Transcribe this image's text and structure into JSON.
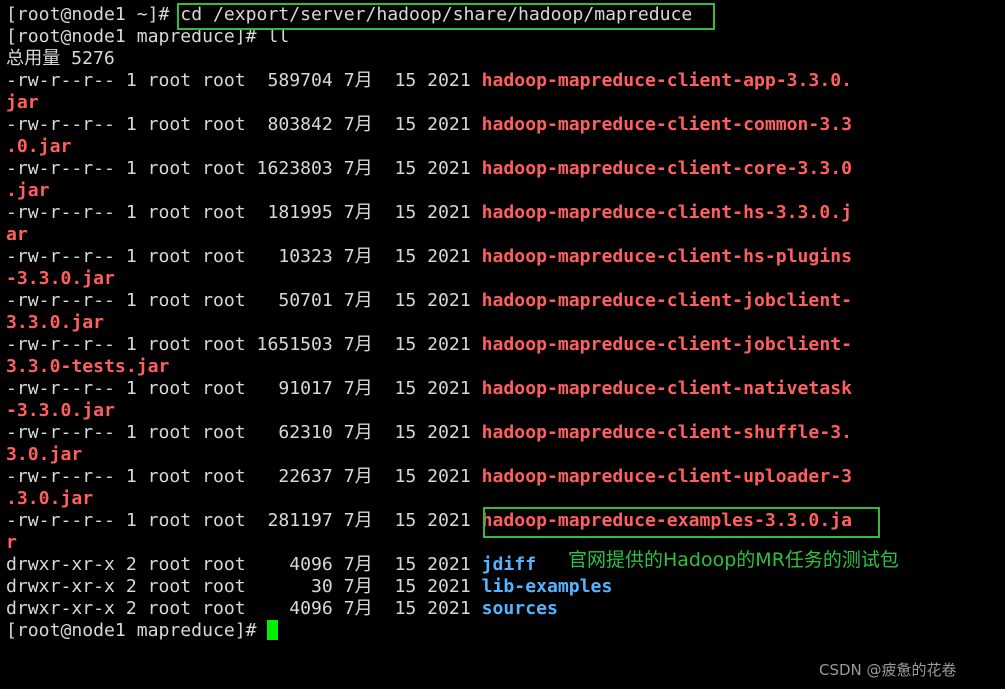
{
  "terminal": {
    "line1_prompt": "[root@node1 ~]# ",
    "line1_command": "cd /export/server/hadoop/share/hadoop/mapreduce",
    "line2_prompt": "[root@node1 mapreduce]# ",
    "line2_command": "ll",
    "total": "总用量 5276",
    "files": [
      {
        "info": "-rw-r--r-- 1 root root  589704 7月  15 2021 ",
        "name_line1": "hadoop-mapreduce-client-app-3.3.0.",
        "name_line2": "jar"
      },
      {
        "info": "-rw-r--r-- 1 root root  803842 7月  15 2021 ",
        "name_line1": "hadoop-mapreduce-client-common-3.3",
        "name_line2": ".0.jar"
      },
      {
        "info": "-rw-r--r-- 1 root root 1623803 7月  15 2021 ",
        "name_line1": "hadoop-mapreduce-client-core-3.3.0",
        "name_line2": ".jar"
      },
      {
        "info": "-rw-r--r-- 1 root root  181995 7月  15 2021 ",
        "name_line1": "hadoop-mapreduce-client-hs-3.3.0.j",
        "name_line2": "ar"
      },
      {
        "info": "-rw-r--r-- 1 root root   10323 7月  15 2021 ",
        "name_line1": "hadoop-mapreduce-client-hs-plugins",
        "name_line2": "-3.3.0.jar"
      },
      {
        "info": "-rw-r--r-- 1 root root   50701 7月  15 2021 ",
        "name_line1": "hadoop-mapreduce-client-jobclient-",
        "name_line2": "3.3.0.jar"
      },
      {
        "info": "-rw-r--r-- 1 root root 1651503 7月  15 2021 ",
        "name_line1": "hadoop-mapreduce-client-jobclient-",
        "name_line2": "3.3.0-tests.jar"
      },
      {
        "info": "-rw-r--r-- 1 root root   91017 7月  15 2021 ",
        "name_line1": "hadoop-mapreduce-client-nativetask",
        "name_line2": "-3.3.0.jar"
      },
      {
        "info": "-rw-r--r-- 1 root root   62310 7月  15 2021 ",
        "name_line1": "hadoop-mapreduce-client-shuffle-3.",
        "name_line2": "3.0.jar"
      },
      {
        "info": "-rw-r--r-- 1 root root   22637 7月  15 2021 ",
        "name_line1": "hadoop-mapreduce-client-uploader-3",
        "name_line2": ".3.0.jar"
      },
      {
        "info": "-rw-r--r-- 1 root root  281197 7月  15 2021 ",
        "name_line1": "hadoop-mapreduce-examples-3.3.0.ja",
        "name_line2": "r"
      }
    ],
    "dirs": [
      {
        "info": "drwxr-xr-x 2 root root    4096 7月  15 2021 ",
        "name": "jdiff"
      },
      {
        "info": "drwxr-xr-x 2 root root      30 7月  15 2021 ",
        "name": "lib-examples"
      },
      {
        "info": "drwxr-xr-x 2 root root    4096 7月  15 2021 ",
        "name": "sources"
      }
    ],
    "final_prompt": "[root@node1 mapreduce]# "
  },
  "annotation": "官网提供的Hadoop的MR任务的测试包",
  "watermark": "CSDN @疲惫的花卷",
  "colors": {
    "background": "#000000",
    "text": "#d8d8d8",
    "jar_file": "#ff5f5f",
    "directory": "#55b4ff",
    "highlight_box": "#33bb3a",
    "cursor": "#00ee00"
  }
}
